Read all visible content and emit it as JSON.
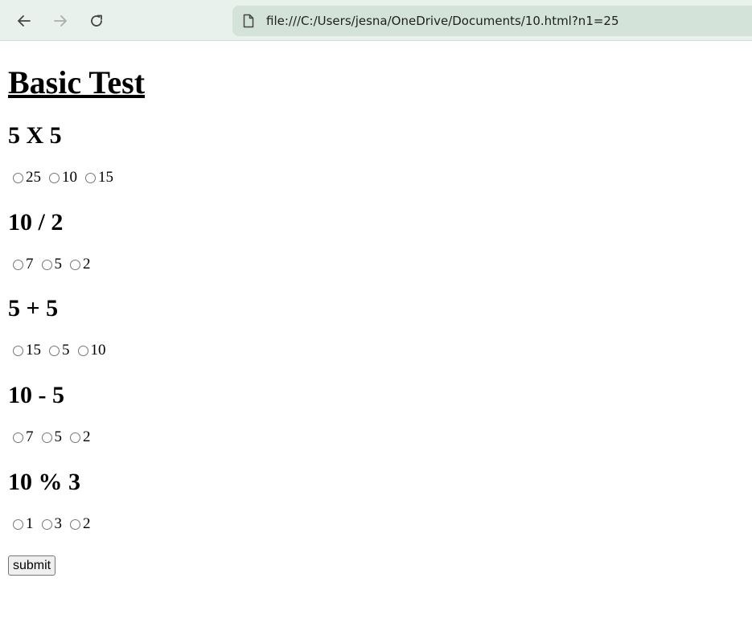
{
  "browser": {
    "url": "file:///C:/Users/jesna/OneDrive/Documents/10.html?n1=25"
  },
  "page": {
    "title": "Basic Test",
    "questions": [
      {
        "text": "5 X 5",
        "options": [
          "25",
          "10",
          "15"
        ]
      },
      {
        "text": "10 / 2",
        "options": [
          "7",
          "5",
          "2"
        ]
      },
      {
        "text": "5 + 5",
        "options": [
          "15",
          "5",
          "10"
        ]
      },
      {
        "text": "10 - 5",
        "options": [
          "7",
          "5",
          "2"
        ]
      },
      {
        "text": "10 % 3",
        "options": [
          "1",
          "3",
          "2"
        ]
      }
    ],
    "submit_label": "submit"
  }
}
